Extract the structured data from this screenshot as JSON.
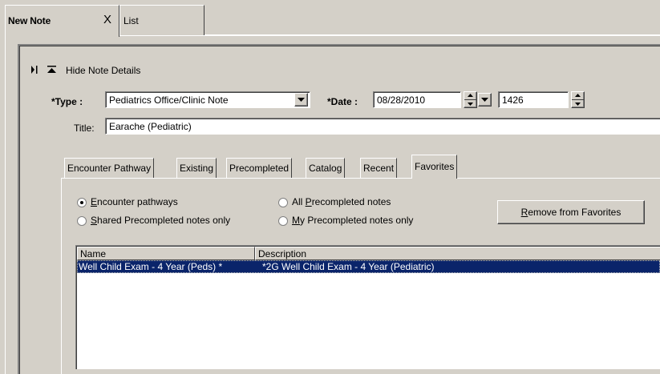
{
  "tabs": [
    {
      "label": "New Note",
      "close": "X"
    },
    {
      "label": "List"
    }
  ],
  "details": {
    "toggle_label": "Hide Note Details"
  },
  "form": {
    "type_label": "*Type :",
    "type_value": "Pediatrics Office/Clinic Note",
    "date_label": "*Date :",
    "date_value": "08/28/2010",
    "time_value": "1426",
    "title_label": "Title:",
    "title_value": "Earache (Pediatric)"
  },
  "subtabs": [
    "Encounter Pathway",
    "Existing",
    "Precompleted",
    "Catalog",
    "Recent",
    "Favorites"
  ],
  "active_subtab": "Favorites",
  "filters": {
    "encounter_pathways": {
      "prefix": "",
      "accel": "E",
      "rest": "ncounter pathways",
      "selected": true
    },
    "all_precompleted": {
      "prefix": "All ",
      "accel": "P",
      "rest": "recompleted notes",
      "selected": false
    },
    "shared_precompleted": {
      "prefix": "",
      "accel": "S",
      "rest": "hared Precompleted notes only",
      "selected": false
    },
    "my_precompleted": {
      "prefix": "",
      "accel": "M",
      "rest": "y Precompleted notes only",
      "selected": false
    }
  },
  "remove_button": {
    "accel": "R",
    "rest": "emove from Favorites"
  },
  "list": {
    "columns": [
      "Name",
      "Description"
    ],
    "rows": [
      {
        "name": "Well Child Exam - 4 Year (Peds) *",
        "description": "*2G Well Child Exam - 4 Year (Pediatric)",
        "selected": true
      }
    ]
  },
  "colors": {
    "window_bg": "#d4d0c8",
    "selection_bg": "#0a246a",
    "selection_fg": "#ffffff"
  }
}
